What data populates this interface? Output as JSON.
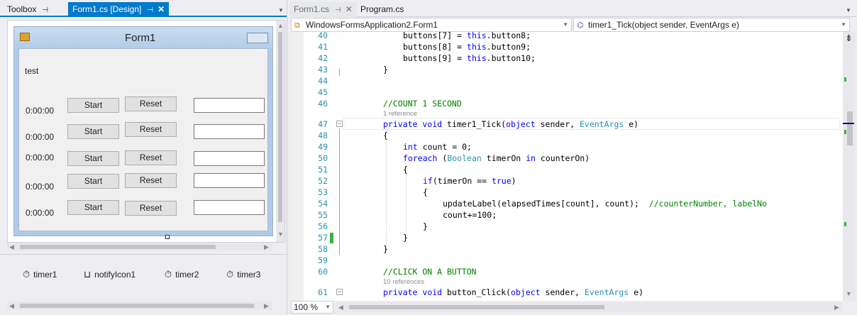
{
  "left_pane": {
    "tabs": {
      "toolbox": "Toolbox",
      "designer": "Form1.cs [Design]"
    },
    "form": {
      "title": "Form1",
      "test_label": "test",
      "rows": [
        {
          "time": "0:00:00",
          "start": "Start",
          "reset": "Reset"
        },
        {
          "time": "0:00:00",
          "start": "Start",
          "reset": "Reset"
        },
        {
          "time": "0:00:00",
          "start": "Start",
          "reset": "Reset"
        },
        {
          "time": "0:00:00",
          "start": "Start",
          "reset": "Reset"
        },
        {
          "time": "0:00:00",
          "start": "Start",
          "reset": "Reset"
        }
      ]
    },
    "tray": [
      "timer1",
      "notifyIcon1",
      "timer2",
      "timer3"
    ]
  },
  "right_pane": {
    "tabs": {
      "form1cs": "Form1.cs",
      "program": "Program.cs"
    },
    "nav": {
      "class_combo": "WindowsFormsApplication2.Form1",
      "member_combo": "timer1_Tick(object sender, EventArgs e)"
    },
    "zoom": "100 %",
    "lens": {
      "ref1": "1 reference",
      "ref10": "10 references"
    },
    "line_numbers": [
      "40",
      "41",
      "42",
      "43",
      "44",
      "45",
      "46",
      "47",
      "48",
      "49",
      "50",
      "51",
      "52",
      "53",
      "54",
      "55",
      "56",
      "57",
      "58",
      "59",
      "60",
      "61"
    ]
  },
  "colors": {
    "accent": "#007acc",
    "keyword": "#0000ff",
    "type": "#2b91af",
    "comment": "#008000",
    "change_marker": "#3cb043"
  }
}
